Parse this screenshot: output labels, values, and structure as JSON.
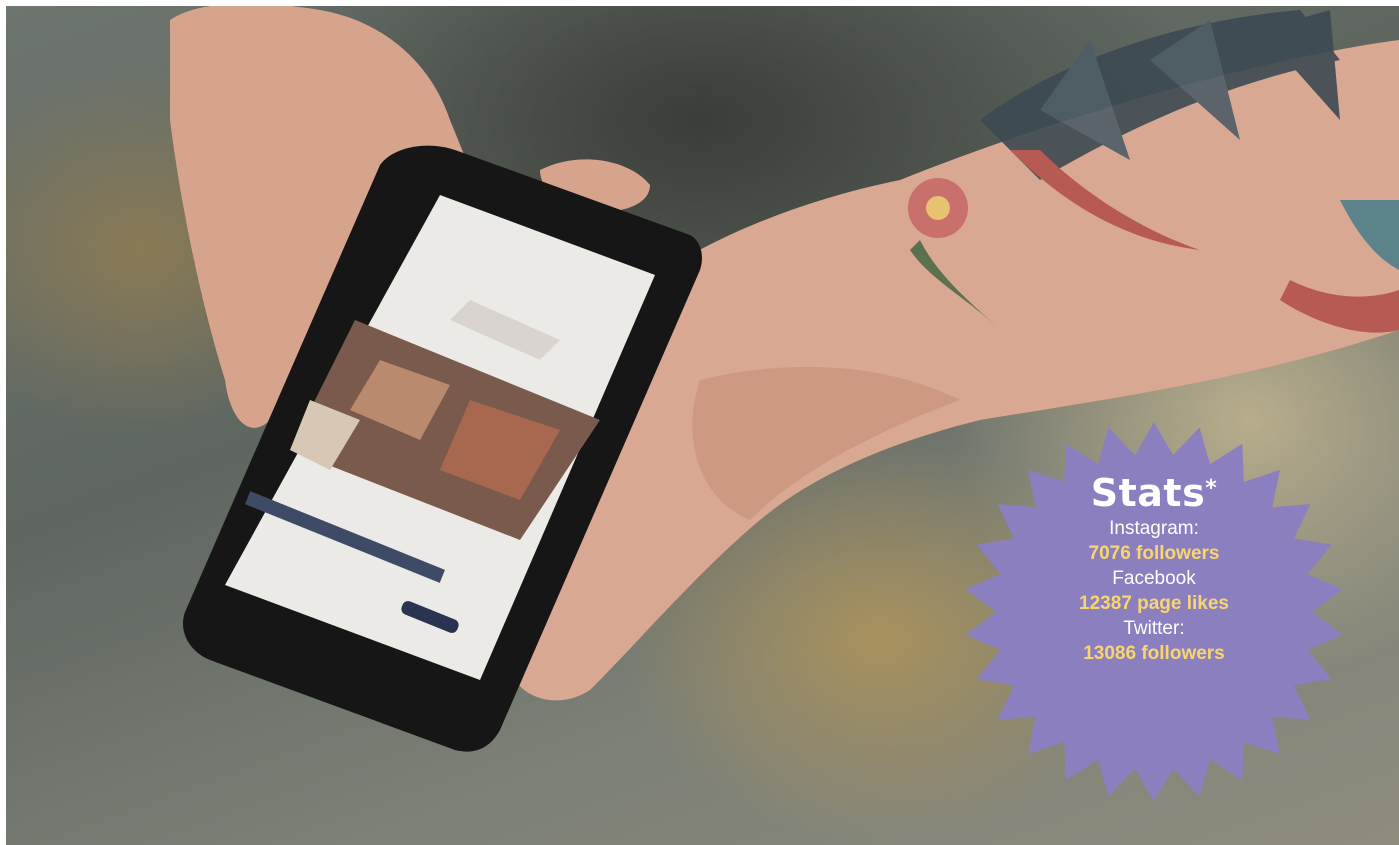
{
  "badge": {
    "title": "Stats",
    "title_mark": "*",
    "color": "#8b7fc0",
    "value_color": "#f9d66b",
    "rows": [
      {
        "label": "Instagram:",
        "value": "7076 followers"
      },
      {
        "label": "Facebook",
        "value": "12387 page likes"
      },
      {
        "label": "Twitter:",
        "value": "13086 followers"
      }
    ]
  }
}
